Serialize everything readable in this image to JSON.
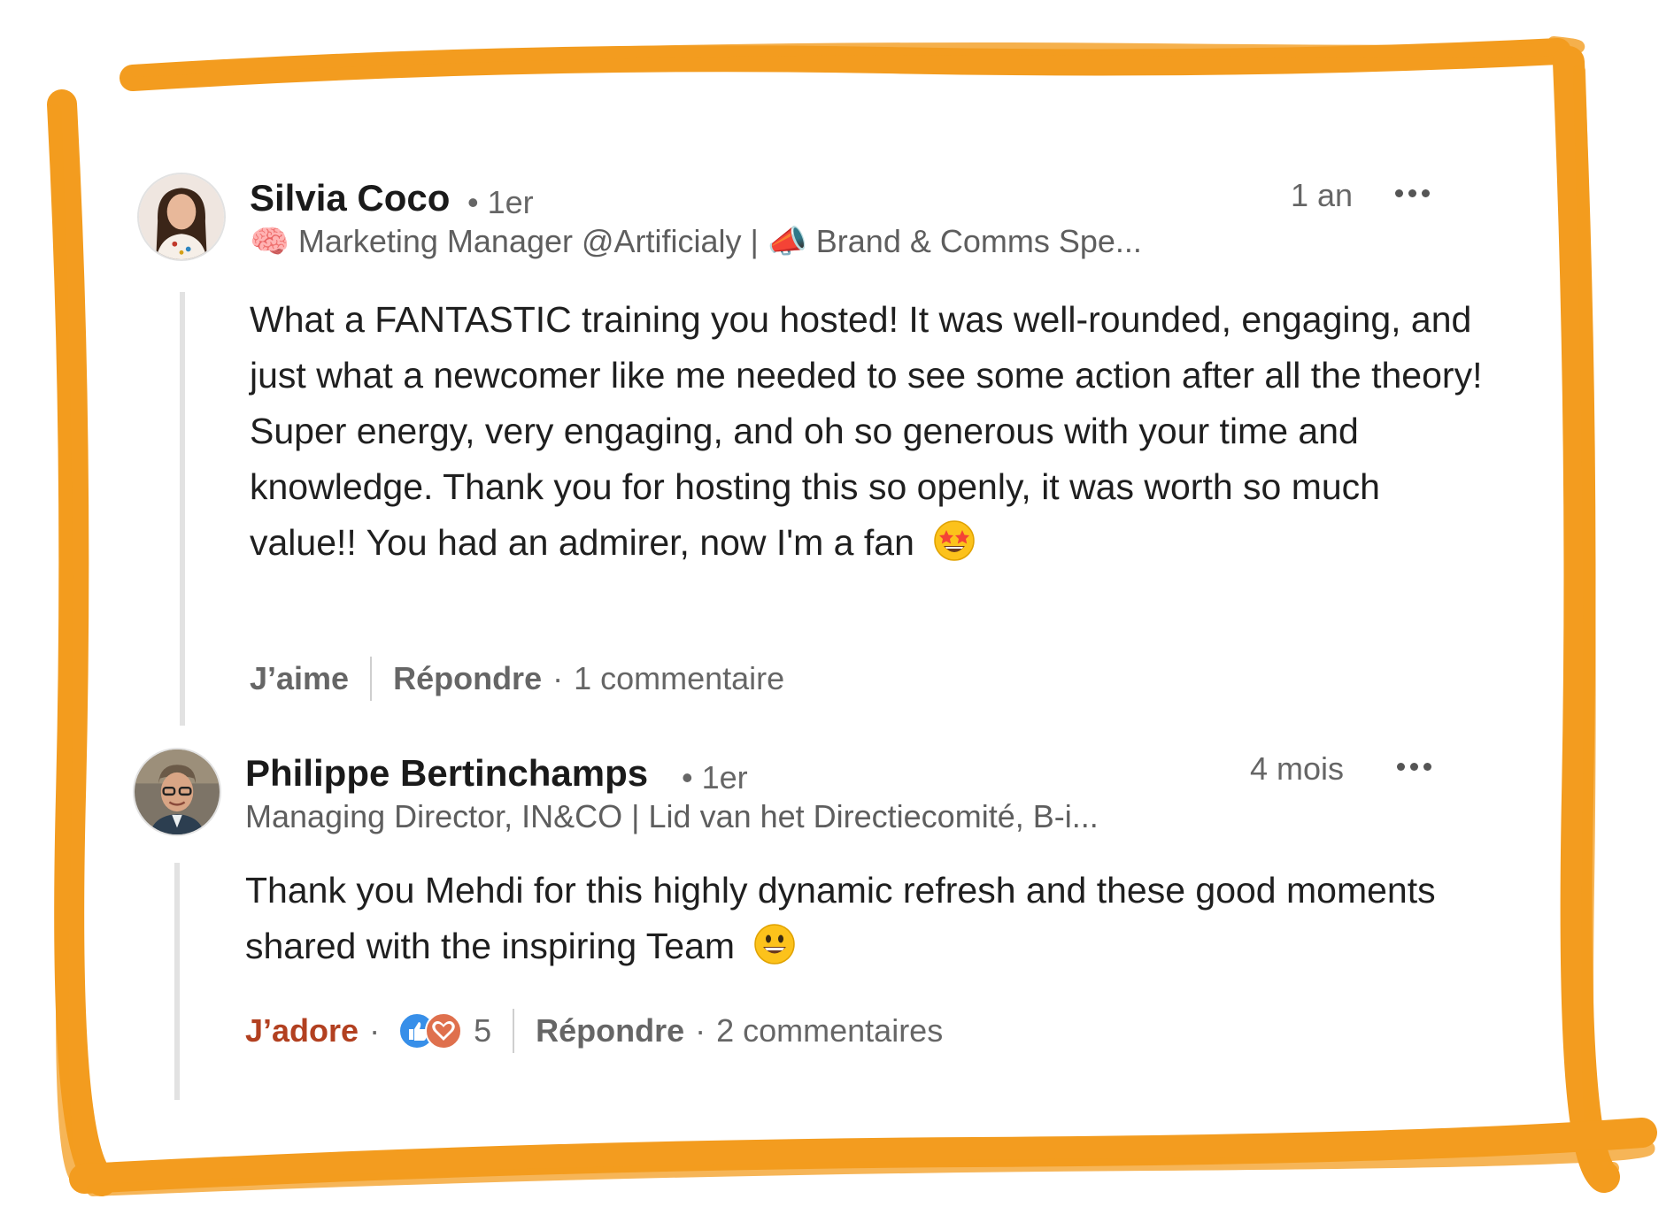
{
  "colors": {
    "frame_orange": "#f39c1f",
    "loved_red": "#b24020",
    "muted_text": "#666666"
  },
  "comments": [
    {
      "author": "Silvia Coco",
      "degree": "• 1er",
      "headline_emoji_1": "🧠",
      "headline_part_1": "Marketing Manager @Artificialy |",
      "headline_emoji_2": "📣",
      "headline_part_2": "Brand & Comms Spe...",
      "time": "1 an",
      "text": "What a FANTASTIC training you hosted! It was well-rounded, engaging, and just what a newcomer like me needed to see some action after all the theory! Super energy, very engaging, and oh so generous with your time and knowledge. Thank you for hosting this so openly, it was worth so much value!! You had an admirer, now I'm a fan",
      "text_emoji": "star-struck",
      "reaction_label": "J’aime",
      "reply_label": "Répondre",
      "reply_count": "1 commentaire"
    },
    {
      "author": "Philippe Bertinchamps",
      "degree": "• 1er",
      "headline": "Managing Director, IN&CO | Lid van het Directiecomité, B-i...",
      "time": "4 mois",
      "text": "Thank you Mehdi for this highly dynamic refresh and these good moments shared with the inspiring Team",
      "text_emoji": "grinning-face",
      "reaction_label": "J’adore",
      "reaction_icons": [
        "like-icon",
        "love-icon"
      ],
      "reaction_count": "5",
      "reply_label": "Répondre",
      "reply_count": "2 commentaires"
    }
  ]
}
